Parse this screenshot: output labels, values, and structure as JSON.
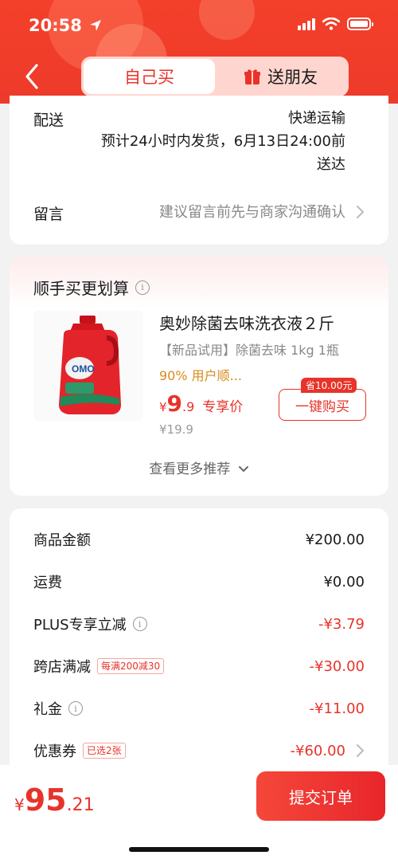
{
  "status": {
    "time": "20:58"
  },
  "tabs": {
    "self_buy": "自己买",
    "gift": "送朋友"
  },
  "delivery": {
    "label": "配送",
    "method": "快递运输",
    "eta_line1": "预计24小时内发货，6月13日24:00前",
    "eta_line2": "送达"
  },
  "note": {
    "label": "留言",
    "placeholder": "建议留言前先与商家沟通确认"
  },
  "recommend": {
    "title": "顺手买更划算",
    "product": {
      "name": "奥妙除菌去味洗衣液２斤",
      "spec": "【新品试用】除菌去味 1kg 1瓶",
      "rating": "90% 用户顺...",
      "price_symbol": "¥",
      "price_int": "9",
      "price_dec": ".9",
      "price_tag": "专享价",
      "original_price": "¥19.9",
      "save_badge": "省10.00元",
      "buy_label": "一键购买"
    },
    "more_label": "查看更多推荐"
  },
  "summary": {
    "rows": [
      {
        "label": "商品金额",
        "value": "¥200.00",
        "tag": "",
        "info": false,
        "red": false
      },
      {
        "label": "运费",
        "value": "¥0.00",
        "tag": "",
        "info": false,
        "red": false
      },
      {
        "label": "PLUS专享立减",
        "value": "-¥3.79",
        "tag": "",
        "info": true,
        "red": true
      },
      {
        "label": "跨店满减",
        "value": "-¥30.00",
        "tag": "每满200减30",
        "info": false,
        "red": true
      },
      {
        "label": "礼金",
        "value": "-¥11.00",
        "tag": "",
        "info": true,
        "red": true
      },
      {
        "label": "优惠券",
        "value": "-¥60.00",
        "tag": "已选2张",
        "info": false,
        "red": true
      }
    ]
  },
  "footer": {
    "total_symbol": "¥",
    "total_int": "95",
    "total_dec": ".21",
    "submit_label": "提交订单"
  },
  "colors": {
    "brand_red": "#e8332a",
    "orange": "#d98b1a"
  }
}
